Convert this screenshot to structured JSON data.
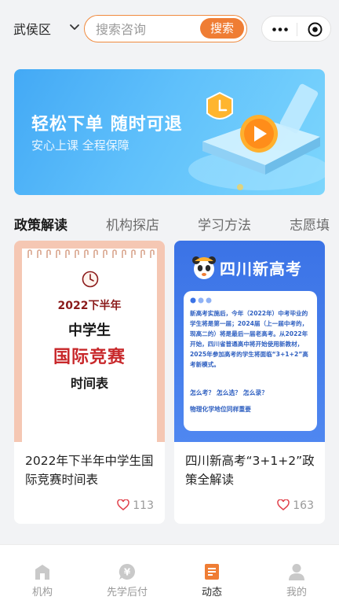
{
  "header": {
    "district": "武侯区",
    "search_placeholder": "搜索咨询",
    "search_button": "搜索"
  },
  "banner": {
    "title": "轻松下单 随时可退",
    "subtitle": "安心上课 全程保障"
  },
  "tabs": [
    {
      "label": "政策解读",
      "active": true
    },
    {
      "label": "机构探店",
      "active": false
    },
    {
      "label": "学习方法",
      "active": false
    },
    {
      "label": "志愿填",
      "active": false
    }
  ],
  "cards": [
    {
      "title": "2022年下半年中学生国际竞赛时间表",
      "likes": "113",
      "poster": {
        "line1": "2022下半年",
        "line2": "中学生",
        "line3": "国际竞赛",
        "line4": "时间表"
      }
    },
    {
      "title": "四川新高考“3+1+2”政策全解读",
      "likes": "163",
      "poster": {
        "heading": "四川新高考",
        "body": "新高考实施后，今年（2022年）中考毕业的学生将是第一届；2024届（上一届中考的，现高二的）将是最后一届老高考。从2022年开始，四川省普通高中将开始使用新教材，2025年参加高考的学生将面临“3+1+2”高考新模式。",
        "questions": "怎么考？  怎么选？  怎么录？",
        "note": "物理化学地位同样重要"
      }
    }
  ],
  "bottom_nav": [
    {
      "label": "机构",
      "icon": "building-icon",
      "active": false
    },
    {
      "label": "先学后付",
      "icon": "yen-bubble-icon",
      "active": false
    },
    {
      "label": "动态",
      "icon": "document-icon",
      "active": true
    },
    {
      "label": "我的",
      "icon": "person-icon",
      "active": false
    }
  ],
  "colors": {
    "accent": "#ef7d34",
    "banner_blue": "#43a9f5",
    "poster_blue": "#3b73e6",
    "poster_pink": "#f5c7b3"
  }
}
